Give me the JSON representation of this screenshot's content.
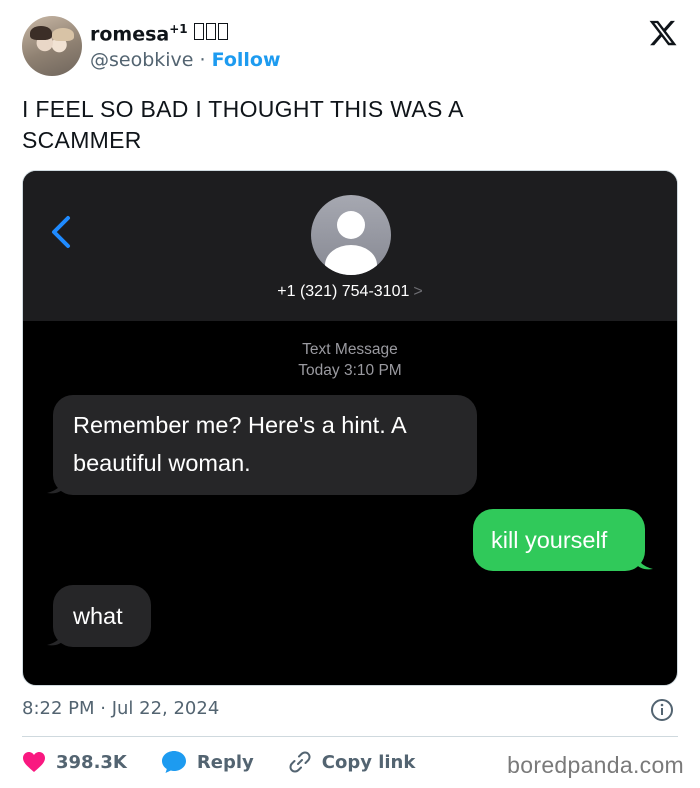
{
  "user": {
    "display_name": "romesa",
    "superscript": "+1",
    "handle": "@seobkive",
    "separator": "·",
    "follow_label": "Follow"
  },
  "tweet": {
    "text": "I FEEL SO BAD I THOUGHT THIS WAS A SCAMMER",
    "timestamp": "8:22 PM · Jul 22, 2024"
  },
  "screenshot": {
    "contact_number": "+1 (321) 754-3101",
    "contact_chevron": ">",
    "conversation_label": "Text Message",
    "conversation_time_day": "Today",
    "conversation_time": "3:10 PM",
    "messages": [
      {
        "direction": "received",
        "text": "Remember me? Here's a hint. A beautiful woman."
      },
      {
        "direction": "sent",
        "text": "kill yourself"
      },
      {
        "direction": "received",
        "text": "what"
      }
    ]
  },
  "actions": {
    "likes": "398.3K",
    "reply_label": "Reply",
    "copy_link_label": "Copy link"
  },
  "watermark": "boredpanda.com",
  "icons": {
    "x_logo": "x-logo-icon",
    "back": "chevron-left-icon",
    "info": "info-icon",
    "like": "heart-icon",
    "reply": "speech-bubble-icon",
    "copy_link": "link-icon"
  },
  "colors": {
    "follow": "#1d9bf0",
    "like": "#f91880",
    "reply": "#1d9bf0",
    "sent_bubble": "#30c95a",
    "received_bubble": "#262628"
  }
}
